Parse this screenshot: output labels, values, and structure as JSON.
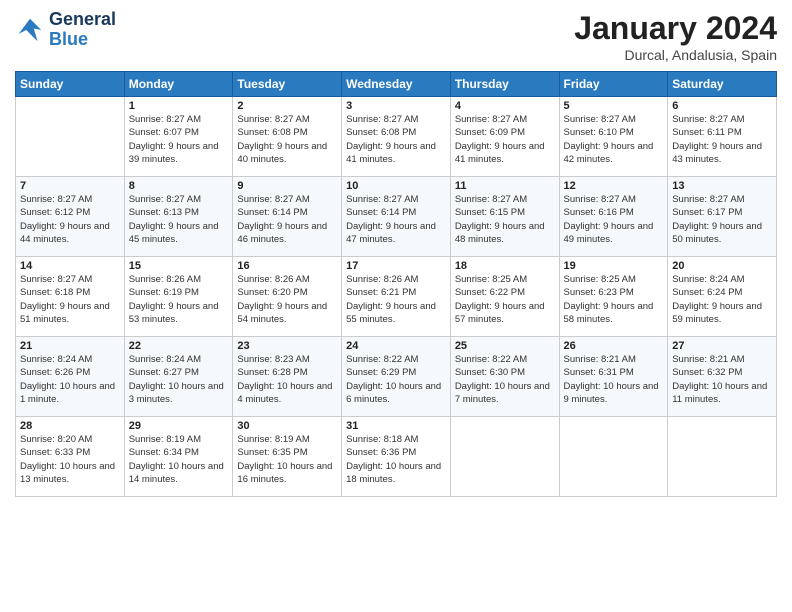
{
  "header": {
    "logo_line1": "General",
    "logo_line2": "Blue",
    "month": "January 2024",
    "location": "Durcal, Andalusia, Spain"
  },
  "weekdays": [
    "Sunday",
    "Monday",
    "Tuesday",
    "Wednesday",
    "Thursday",
    "Friday",
    "Saturday"
  ],
  "weeks": [
    [
      {
        "day": "",
        "sunrise": "",
        "sunset": "",
        "daylight": ""
      },
      {
        "day": "1",
        "sunrise": "Sunrise: 8:27 AM",
        "sunset": "Sunset: 6:07 PM",
        "daylight": "Daylight: 9 hours and 39 minutes."
      },
      {
        "day": "2",
        "sunrise": "Sunrise: 8:27 AM",
        "sunset": "Sunset: 6:08 PM",
        "daylight": "Daylight: 9 hours and 40 minutes."
      },
      {
        "day": "3",
        "sunrise": "Sunrise: 8:27 AM",
        "sunset": "Sunset: 6:08 PM",
        "daylight": "Daylight: 9 hours and 41 minutes."
      },
      {
        "day": "4",
        "sunrise": "Sunrise: 8:27 AM",
        "sunset": "Sunset: 6:09 PM",
        "daylight": "Daylight: 9 hours and 41 minutes."
      },
      {
        "day": "5",
        "sunrise": "Sunrise: 8:27 AM",
        "sunset": "Sunset: 6:10 PM",
        "daylight": "Daylight: 9 hours and 42 minutes."
      },
      {
        "day": "6",
        "sunrise": "Sunrise: 8:27 AM",
        "sunset": "Sunset: 6:11 PM",
        "daylight": "Daylight: 9 hours and 43 minutes."
      }
    ],
    [
      {
        "day": "7",
        "sunrise": "Sunrise: 8:27 AM",
        "sunset": "Sunset: 6:12 PM",
        "daylight": "Daylight: 9 hours and 44 minutes."
      },
      {
        "day": "8",
        "sunrise": "Sunrise: 8:27 AM",
        "sunset": "Sunset: 6:13 PM",
        "daylight": "Daylight: 9 hours and 45 minutes."
      },
      {
        "day": "9",
        "sunrise": "Sunrise: 8:27 AM",
        "sunset": "Sunset: 6:14 PM",
        "daylight": "Daylight: 9 hours and 46 minutes."
      },
      {
        "day": "10",
        "sunrise": "Sunrise: 8:27 AM",
        "sunset": "Sunset: 6:14 PM",
        "daylight": "Daylight: 9 hours and 47 minutes."
      },
      {
        "day": "11",
        "sunrise": "Sunrise: 8:27 AM",
        "sunset": "Sunset: 6:15 PM",
        "daylight": "Daylight: 9 hours and 48 minutes."
      },
      {
        "day": "12",
        "sunrise": "Sunrise: 8:27 AM",
        "sunset": "Sunset: 6:16 PM",
        "daylight": "Daylight: 9 hours and 49 minutes."
      },
      {
        "day": "13",
        "sunrise": "Sunrise: 8:27 AM",
        "sunset": "Sunset: 6:17 PM",
        "daylight": "Daylight: 9 hours and 50 minutes."
      }
    ],
    [
      {
        "day": "14",
        "sunrise": "Sunrise: 8:27 AM",
        "sunset": "Sunset: 6:18 PM",
        "daylight": "Daylight: 9 hours and 51 minutes."
      },
      {
        "day": "15",
        "sunrise": "Sunrise: 8:26 AM",
        "sunset": "Sunset: 6:19 PM",
        "daylight": "Daylight: 9 hours and 53 minutes."
      },
      {
        "day": "16",
        "sunrise": "Sunrise: 8:26 AM",
        "sunset": "Sunset: 6:20 PM",
        "daylight": "Daylight: 9 hours and 54 minutes."
      },
      {
        "day": "17",
        "sunrise": "Sunrise: 8:26 AM",
        "sunset": "Sunset: 6:21 PM",
        "daylight": "Daylight: 9 hours and 55 minutes."
      },
      {
        "day": "18",
        "sunrise": "Sunrise: 8:25 AM",
        "sunset": "Sunset: 6:22 PM",
        "daylight": "Daylight: 9 hours and 57 minutes."
      },
      {
        "day": "19",
        "sunrise": "Sunrise: 8:25 AM",
        "sunset": "Sunset: 6:23 PM",
        "daylight": "Daylight: 9 hours and 58 minutes."
      },
      {
        "day": "20",
        "sunrise": "Sunrise: 8:24 AM",
        "sunset": "Sunset: 6:24 PM",
        "daylight": "Daylight: 9 hours and 59 minutes."
      }
    ],
    [
      {
        "day": "21",
        "sunrise": "Sunrise: 8:24 AM",
        "sunset": "Sunset: 6:26 PM",
        "daylight": "Daylight: 10 hours and 1 minute."
      },
      {
        "day": "22",
        "sunrise": "Sunrise: 8:24 AM",
        "sunset": "Sunset: 6:27 PM",
        "daylight": "Daylight: 10 hours and 3 minutes."
      },
      {
        "day": "23",
        "sunrise": "Sunrise: 8:23 AM",
        "sunset": "Sunset: 6:28 PM",
        "daylight": "Daylight: 10 hours and 4 minutes."
      },
      {
        "day": "24",
        "sunrise": "Sunrise: 8:22 AM",
        "sunset": "Sunset: 6:29 PM",
        "daylight": "Daylight: 10 hours and 6 minutes."
      },
      {
        "day": "25",
        "sunrise": "Sunrise: 8:22 AM",
        "sunset": "Sunset: 6:30 PM",
        "daylight": "Daylight: 10 hours and 7 minutes."
      },
      {
        "day": "26",
        "sunrise": "Sunrise: 8:21 AM",
        "sunset": "Sunset: 6:31 PM",
        "daylight": "Daylight: 10 hours and 9 minutes."
      },
      {
        "day": "27",
        "sunrise": "Sunrise: 8:21 AM",
        "sunset": "Sunset: 6:32 PM",
        "daylight": "Daylight: 10 hours and 11 minutes."
      }
    ],
    [
      {
        "day": "28",
        "sunrise": "Sunrise: 8:20 AM",
        "sunset": "Sunset: 6:33 PM",
        "daylight": "Daylight: 10 hours and 13 minutes."
      },
      {
        "day": "29",
        "sunrise": "Sunrise: 8:19 AM",
        "sunset": "Sunset: 6:34 PM",
        "daylight": "Daylight: 10 hours and 14 minutes."
      },
      {
        "day": "30",
        "sunrise": "Sunrise: 8:19 AM",
        "sunset": "Sunset: 6:35 PM",
        "daylight": "Daylight: 10 hours and 16 minutes."
      },
      {
        "day": "31",
        "sunrise": "Sunrise: 8:18 AM",
        "sunset": "Sunset: 6:36 PM",
        "daylight": "Daylight: 10 hours and 18 minutes."
      },
      {
        "day": "",
        "sunrise": "",
        "sunset": "",
        "daylight": ""
      },
      {
        "day": "",
        "sunrise": "",
        "sunset": "",
        "daylight": ""
      },
      {
        "day": "",
        "sunrise": "",
        "sunset": "",
        "daylight": ""
      }
    ]
  ]
}
